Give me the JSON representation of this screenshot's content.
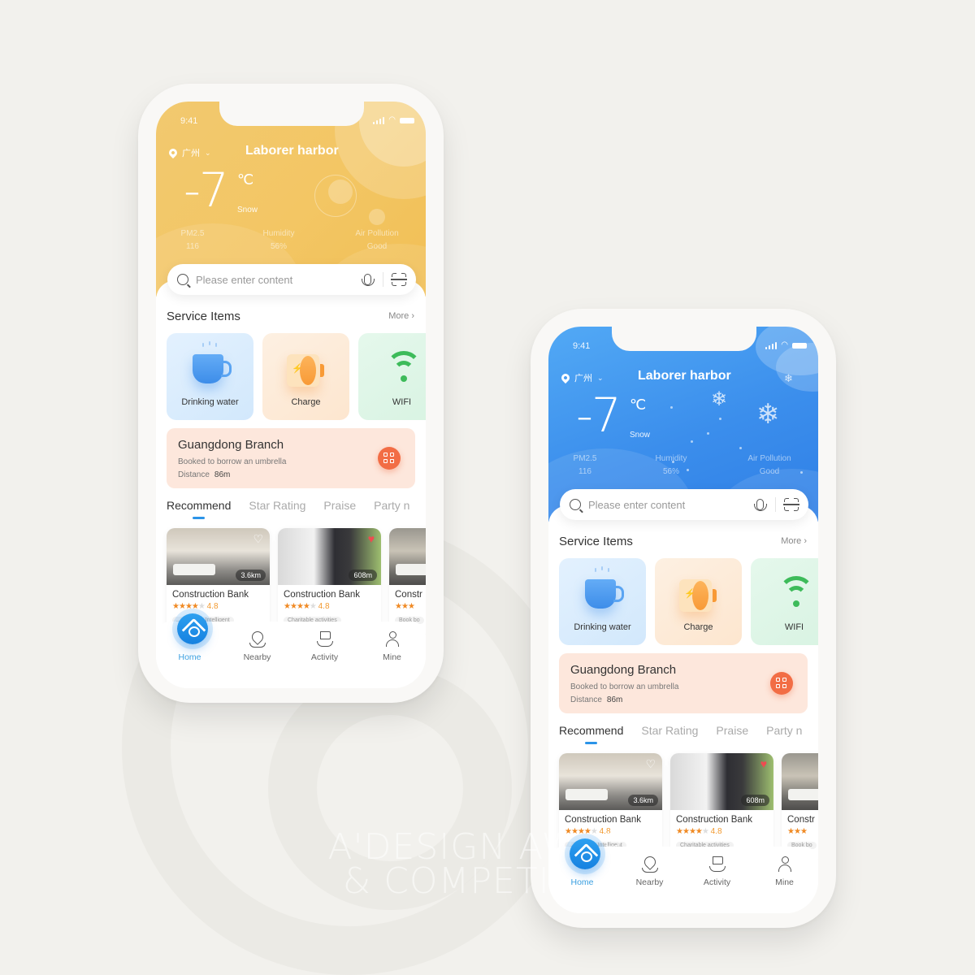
{
  "watermark": {
    "line1": "A'DESIGN AWARD",
    "line2": "& COMPETITION"
  },
  "phones": [
    {
      "theme": "yellow",
      "status": {
        "time": "9:41"
      },
      "header": {
        "city": "广州",
        "title": "Laborer harbor",
        "temperature": "-7",
        "unit": "℃",
        "condition": "Snow",
        "stats": [
          {
            "label": "PM2.5",
            "value": "116"
          },
          {
            "label": "Humidity",
            "value": "56%"
          },
          {
            "label": "Air Pollution",
            "value": "Good"
          }
        ]
      },
      "search": {
        "placeholder": "Please enter content",
        "value": ""
      },
      "services": {
        "title": "Service Items",
        "more_label": "More",
        "items": [
          {
            "label": "Drinking water",
            "icon": "cup-icon"
          },
          {
            "label": "Charge",
            "icon": "battery-icon"
          },
          {
            "label": "WIFI",
            "icon": "wifi-icon"
          }
        ]
      },
      "branch": {
        "title": "Guangdong Branch",
        "subtitle": "Booked to borrow an umbrella",
        "distance_label": "Distance",
        "distance_value": "86m"
      },
      "tabs": [
        "Recommend",
        "Star Rating",
        "Praise",
        "Party n"
      ],
      "active_tab": 0,
      "cards": [
        {
          "name": "Construction Bank",
          "rating": "4.8",
          "stars": 4,
          "distance": "3.6km",
          "favorite": false,
          "tags": [
            "...ving",
            "Intelligent"
          ]
        },
        {
          "name": "Construction Bank",
          "rating": "4.8",
          "stars": 4,
          "distance": "608m",
          "favorite": true,
          "tags": [
            "Charitable activities"
          ]
        },
        {
          "name": "Constr",
          "rating": "",
          "stars": 3,
          "distance": "",
          "favorite": false,
          "tags": [
            "Book bo"
          ]
        }
      ],
      "tabbar": [
        {
          "label": "Home",
          "icon": "home-icon",
          "active": true
        },
        {
          "label": "Nearby",
          "icon": "location-pin-icon",
          "active": false
        },
        {
          "label": "Activity",
          "icon": "flag-icon",
          "active": false
        },
        {
          "label": "Mine",
          "icon": "user-icon",
          "active": false
        }
      ]
    },
    {
      "theme": "blue",
      "status": {
        "time": "9:41"
      },
      "header": {
        "city": "广州",
        "title": "Laborer harbor",
        "temperature": "-7",
        "unit": "℃",
        "condition": "Snow",
        "stats": [
          {
            "label": "PM2.5",
            "value": "116"
          },
          {
            "label": "Humidity",
            "value": "56%"
          },
          {
            "label": "Air Pollution",
            "value": "Good"
          }
        ]
      },
      "search": {
        "placeholder": "Please enter content",
        "value": ""
      },
      "services": {
        "title": "Service Items",
        "more_label": "More",
        "items": [
          {
            "label": "Drinking water",
            "icon": "cup-icon"
          },
          {
            "label": "Charge",
            "icon": "battery-icon"
          },
          {
            "label": "WIFI",
            "icon": "wifi-icon"
          }
        ]
      },
      "branch": {
        "title": "Guangdong Branch",
        "subtitle": "Booked to borrow an umbrella",
        "distance_label": "Distance",
        "distance_value": "86m"
      },
      "tabs": [
        "Recommend",
        "Star Rating",
        "Praise",
        "Party n"
      ],
      "active_tab": 0,
      "cards": [
        {
          "name": "Construction Bank",
          "rating": "4.8",
          "stars": 4,
          "distance": "3.6km",
          "favorite": false,
          "tags": [
            "...ving",
            "Intelligent"
          ]
        },
        {
          "name": "Construction Bank",
          "rating": "4.8",
          "stars": 4,
          "distance": "608m",
          "favorite": true,
          "tags": [
            "Charitable activities"
          ]
        },
        {
          "name": "Constr",
          "rating": "",
          "stars": 3,
          "distance": "",
          "favorite": false,
          "tags": [
            "Book bo"
          ]
        }
      ],
      "tabbar": [
        {
          "label": "Home",
          "icon": "home-icon",
          "active": true
        },
        {
          "label": "Nearby",
          "icon": "location-pin-icon",
          "active": false
        },
        {
          "label": "Activity",
          "icon": "flag-icon",
          "active": false
        },
        {
          "label": "Mine",
          "icon": "user-icon",
          "active": false
        }
      ]
    }
  ],
  "colors": {
    "background": "#f2f1ed",
    "yellow_header": "#f2c96f",
    "blue_header": "#3b8eec",
    "accent_blue": "#2b94e8",
    "qr_orange": "#f26d45",
    "branch_bg": "#fde7dc",
    "star": "#f08a24",
    "favorite_red": "#ef4b50"
  }
}
